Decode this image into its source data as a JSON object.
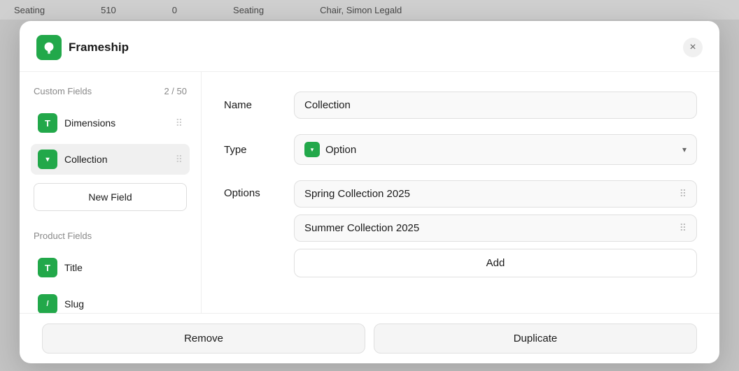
{
  "bg": {
    "col1": "Seating",
    "col2": "510",
    "col3": "0",
    "col4": "Seating",
    "col5": "Chair, Simon Legald"
  },
  "modal": {
    "brand": "Frameship",
    "close_label": "×",
    "sidebar": {
      "custom_fields_label": "Custom Fields",
      "custom_fields_count": "2 / 50",
      "fields": [
        {
          "id": "dimensions",
          "label": "Dimensions",
          "icon_type": "T",
          "icon_color": "green"
        },
        {
          "id": "collection",
          "label": "Collection",
          "icon_type": "▾",
          "icon_color": "green-down",
          "active": true
        }
      ],
      "new_field_label": "New Field",
      "product_fields_label": "Product Fields",
      "product_fields": [
        {
          "id": "title",
          "label": "Title",
          "icon_type": "T",
          "icon_color": "green"
        },
        {
          "id": "slug",
          "label": "Slug",
          "icon_type": "/",
          "icon_color": "green"
        }
      ]
    },
    "detail": {
      "name_label": "Name",
      "name_value": "Collection",
      "type_label": "Type",
      "type_value": "Option",
      "options_label": "Options",
      "options": [
        {
          "id": "spring",
          "text": "Spring Collection 2025"
        },
        {
          "id": "summer",
          "text": "Summer Collection 2025"
        }
      ],
      "add_label": "Add"
    },
    "footer": {
      "remove_label": "Remove",
      "duplicate_label": "Duplicate"
    }
  }
}
